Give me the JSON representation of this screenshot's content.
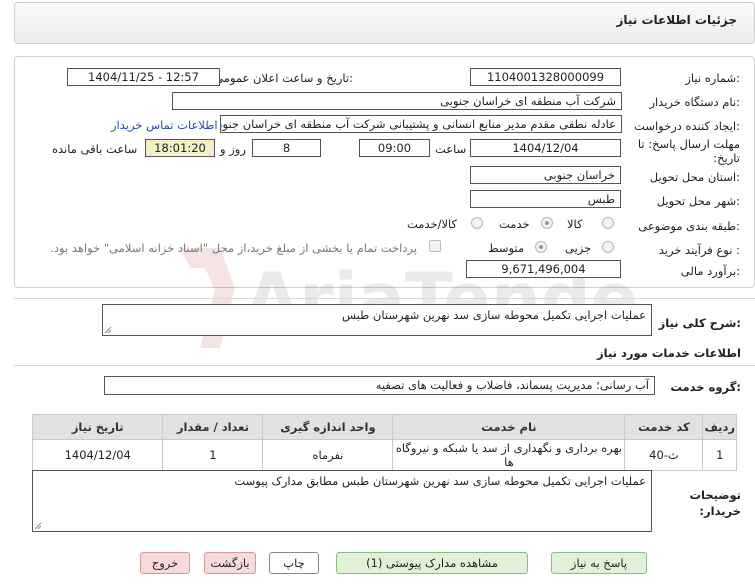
{
  "header": {
    "title": "جزئیات اطلاعات نیاز"
  },
  "form": {
    "need_number_label": "شماره نیاز:",
    "need_number": "1104001328000099",
    "announce_label": "تاریخ و ساعت اعلان عمومی:",
    "announce_value": "1404/11/25 - 12:57",
    "buyer_org_label": "نام دستگاه خریدار:",
    "buyer_org": "شرکت آب منطقه ای خراسان جنوبی",
    "requester_label": "ایجاد کننده درخواست:",
    "requester": "عادله نطقی مقدم مدیر منابع انسانی و پشتیبانی شرکت آب منطقه ای خراسان جنوبی",
    "contact_link": "اطلاعات تماس خریدار",
    "deadline_label": "مهلت ارسال پاسخ: تا تاریخ:",
    "deadline_date": "1404/12/04",
    "time_label": "ساعت",
    "deadline_time": "09:00",
    "days_value": "8",
    "days_label": "روز و",
    "remaining_time": "18:01:20",
    "remaining_label": "ساعت باقی مانده",
    "province_label": "استان محل تحویل:",
    "province": "خراسان جنوبی",
    "city_label": "شهر محل تحویل:",
    "city": "طبس",
    "category_label": "طبقه بندی موضوعی:",
    "category_options": [
      "کالا",
      "خدمت",
      "کالا/خدمت"
    ],
    "category_selected": "خدمت",
    "process_label": "نوع فرآیند خرید :",
    "process_options": [
      "جزیی",
      "متوسط"
    ],
    "process_selected": "متوسط",
    "payment_note": "پرداخت تمام یا بخشی از مبلغ خرید،از محل \"اسناد خزانه اسلامی\" خواهد بود.",
    "estimate_label": "برآورد مالی:",
    "estimate": "9,671,496,004"
  },
  "summary": {
    "label": "شرح کلی نیاز:",
    "text": "عملیات اجرایی تکمیل محوطه سازی سد نهرین شهرستان طبس"
  },
  "services": {
    "section_title": "اطلاعات خدمات مورد نیاز",
    "group_label": "گروه خدمت:",
    "group_value": "آب رسانی؛ مدیریت پسماند، فاضلاب و فعالیت های تصفیه",
    "columns": [
      "ردیف",
      "کد خدمت",
      "نام خدمت",
      "واحد اندازه گیری",
      "تعداد / مقدار",
      "تاریخ نیاز"
    ],
    "rows": [
      [
        "1",
        "ث-40",
        "بهره برداری و نگهداری از سد یا شبکه و نیروگاه ها",
        "نفرماه",
        "1",
        "1404/12/04"
      ]
    ]
  },
  "buyer_notes": {
    "label": "توضیحات خریدار:",
    "text": "عملیات اجرایی تکمیل محوطه سازی سد نهرین شهرستان طبس مطابق مدارک پیوست"
  },
  "actions": {
    "reply": "پاسخ به نیاز",
    "view_docs": "مشاهده مدارک پیوستی (1)",
    "print": "چاپ",
    "back": "بازگشت",
    "exit": "خروج"
  },
  "watermark": {
    "text": "AriaTender.neT"
  },
  "colors": {
    "link": "#1f4fb0",
    "yellow_field": "#f3efc7",
    "green_button": "#dff2d8",
    "pink_button": "#f8dada"
  }
}
